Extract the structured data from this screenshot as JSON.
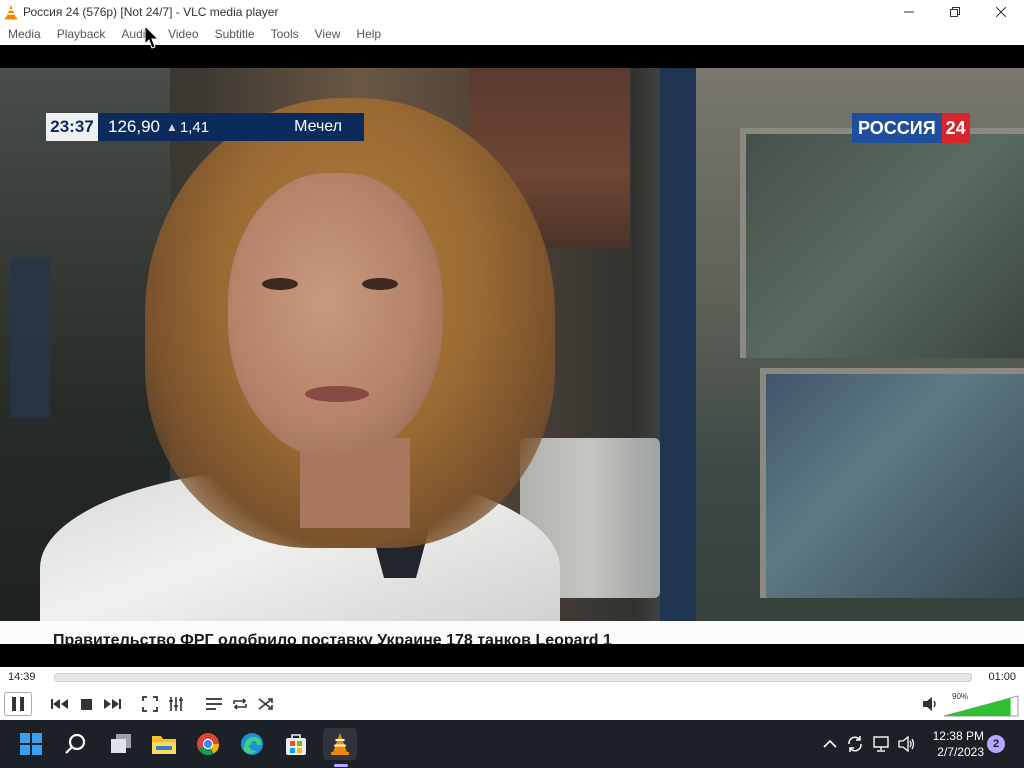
{
  "window": {
    "title": "Россия 24 (576p) [Not 24/7] - VLC media player",
    "controls": [
      "minimize-icon",
      "maximize-icon",
      "close-icon"
    ]
  },
  "menu": {
    "items": [
      {
        "label": "Media"
      },
      {
        "label": "Playback"
      },
      {
        "label": "Audio"
      },
      {
        "label": "Video"
      },
      {
        "label": "Subtitle"
      },
      {
        "label": "Tools"
      },
      {
        "label": "View"
      },
      {
        "label": "Help"
      }
    ]
  },
  "video": {
    "ticker": {
      "time": "23:37",
      "value": "126,90",
      "change": "1,41",
      "company": "Мечел"
    },
    "logo": {
      "text": "РОССИЯ",
      "number": "24",
      "brand_blue": "#1f4f9c",
      "brand_red": "#d6262c"
    },
    "caption": "Правительство ФРГ одобрило поставку Украине 178 танков Leopard 1"
  },
  "playback": {
    "elapsed": "14:39",
    "remaining": "01:00",
    "volume_percent": "90%",
    "volume_level": 0.9,
    "volume_color": "#2fc02f"
  },
  "controls": [
    "pause-icon",
    "previous-icon",
    "stop-icon",
    "next-icon",
    "fullscreen-icon",
    "extended-settings-icon",
    "playlist-icon",
    "loop-icon",
    "shuffle-icon"
  ],
  "taskbar": {
    "apps": [
      "windows-start-icon",
      "search-icon",
      "task-view-icon",
      "file-explorer-icon",
      "chrome-icon",
      "edge-icon",
      "microsoft-store-icon",
      "vlc-icon"
    ],
    "tray_icons": [
      "chevron-up-icon",
      "sync-icon",
      "network-icon",
      "volume-icon"
    ],
    "time": "12:38 PM",
    "date": "2/7/2023",
    "notification_count": "2"
  }
}
